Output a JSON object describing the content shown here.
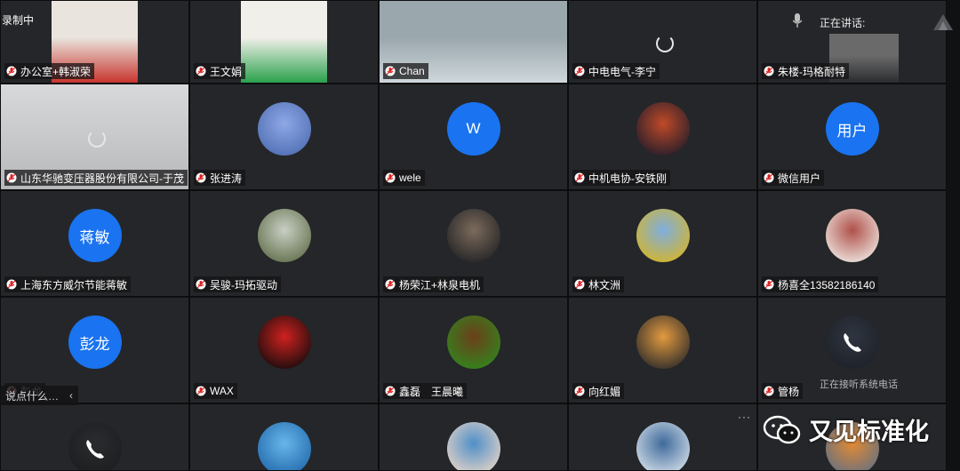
{
  "recording_label": "录制中",
  "speaking_label": "正在讲话:",
  "toast_text": "说点什么…",
  "phone_status": "正在接听系统电话",
  "watermark_text": "又见标准化",
  "participants": [
    {
      "name": "办公室+韩淑荣",
      "kind": "video",
      "colors": [
        "#c7352e",
        "#e9e4dd"
      ]
    },
    {
      "name": "王文娟",
      "kind": "video",
      "colors": [
        "#2aa14c",
        "#f1efe9"
      ]
    },
    {
      "name": "Chan",
      "kind": "video",
      "colors": [
        "#cfd7dc",
        "#9aa7ad"
      ]
    },
    {
      "name": "中电电气-李宁",
      "kind": "loading",
      "colors": [
        "#3d3b3a",
        "#3d3b3a"
      ]
    },
    {
      "name": "朱楼-玛格耐特",
      "kind": "video",
      "colors": [
        "#2a2c2f",
        "#6a6a6a"
      ]
    },
    {
      "name": "山东华驰变压器股份有限公司-于茂",
      "kind": "loading",
      "colors": [
        "#b7b8ba",
        "#d7d9da"
      ]
    },
    {
      "name": "张进涛",
      "kind": "image",
      "colors": [
        "#4b6bb0",
        "#8fa8e6"
      ]
    },
    {
      "name": "wele",
      "kind": "text",
      "avatar_text": "W"
    },
    {
      "name": "中机电协-安铁刚",
      "kind": "image",
      "colors": [
        "#1a1a2a",
        "#c04a28"
      ]
    },
    {
      "name": "微信用户",
      "kind": "text",
      "avatar_text": "用户"
    },
    {
      "name": "上海东方威尔节能蒋敏",
      "kind": "text",
      "avatar_text": "蒋敏"
    },
    {
      "name": "吴骏-玛拓驱动",
      "kind": "image",
      "colors": [
        "#5d6b46",
        "#c9cfc4"
      ]
    },
    {
      "name": "杨荣江+林泉电机",
      "kind": "image",
      "colors": [
        "#1e1f22",
        "#7c6b5c"
      ]
    },
    {
      "name": "林文洲",
      "kind": "image",
      "colors": [
        "#d9b51f",
        "#7faee0"
      ]
    },
    {
      "name": "杨喜全13582186140",
      "kind": "image",
      "colors": [
        "#f2efe9",
        "#b0504a"
      ]
    },
    {
      "name": "彭龙",
      "kind": "text",
      "avatar_text": "彭龙"
    },
    {
      "name": "WAX",
      "kind": "image",
      "colors": [
        "#0b0b0b",
        "#d0211f"
      ]
    },
    {
      "name": "鑫磊　王晨曦",
      "kind": "image",
      "colors": [
        "#2e8a1e",
        "#6b3f1a"
      ]
    },
    {
      "name": "向红媚",
      "kind": "image",
      "colors": [
        "#242629",
        "#e39a3f"
      ]
    },
    {
      "name": "管杨",
      "kind": "phone",
      "colors": [
        "#2f3540",
        "#1c2027"
      ]
    },
    {
      "name": "",
      "kind": "phone",
      "colors": [
        "#2a2c2f",
        "#1b1c1e"
      ]
    },
    {
      "name": "",
      "kind": "image",
      "colors": [
        "#1e64a8",
        "#67b6ea"
      ]
    },
    {
      "name": "",
      "kind": "image",
      "colors": [
        "#f1d9c6",
        "#4f8fc9"
      ]
    },
    {
      "name": "",
      "kind": "image",
      "colors": [
        "#dfe7ee",
        "#3e6a9b"
      ]
    },
    {
      "name": "",
      "kind": "image",
      "colors": [
        "#5d6e86",
        "#e28a33"
      ]
    }
  ],
  "row5_labels": {
    "t16_obscured": "彭龙"
  }
}
